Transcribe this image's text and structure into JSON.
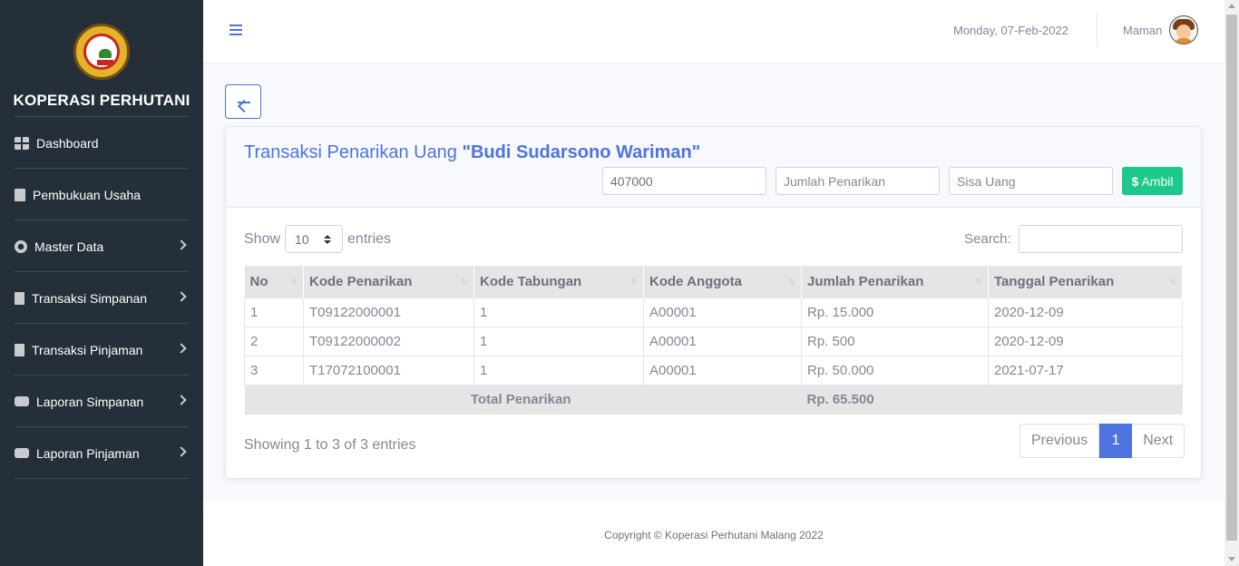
{
  "sidebar": {
    "brand": "KOPERASI PERHUTANI",
    "items": [
      {
        "label": "Dashboard"
      },
      {
        "label": "Pembukuan Usaha"
      },
      {
        "label": "Master Data"
      },
      {
        "label": "Transaksi Simpanan"
      },
      {
        "label": "Transaksi Pinjaman"
      },
      {
        "label": "Laporan Simpanan"
      },
      {
        "label": "Laporan Pinjaman"
      }
    ]
  },
  "topbar": {
    "date": "Monday, 07-Feb-2022",
    "user": "Maman"
  },
  "card": {
    "title_prefix": "Transaksi Penarikan Uang",
    "title_name": "\"Budi Sudarsono Wariman\"",
    "saldo_value": "407000",
    "jumlah_placeholder": "Jumlah Penarikan",
    "sisa_placeholder": "Sisa Uang",
    "ambil_label": "Ambil"
  },
  "table_controls": {
    "show_label": "Show",
    "entries_value": "10",
    "entries_label": "entries",
    "search_label": "Search:"
  },
  "table": {
    "headers": [
      "No",
      "Kode Penarikan",
      "Kode Tabungan",
      "Kode Anggota",
      "Jumlah Penarikan",
      "Tanggal Penarikan"
    ],
    "rows": [
      [
        "1",
        "T09122000001",
        "1",
        "A00001",
        "Rp. 15.000",
        "2020-12-09"
      ],
      [
        "2",
        "T09122000002",
        "1",
        "A00001",
        "Rp. 500",
        "2020-12-09"
      ],
      [
        "3",
        "T17072100001",
        "1",
        "A00001",
        "Rp. 50.000",
        "2021-07-17"
      ]
    ],
    "total_label": "Total Penarikan",
    "total_value": "Rp. 65.500"
  },
  "pagination": {
    "info": "Showing 1 to 3 of 3 entries",
    "previous": "Previous",
    "current": "1",
    "next": "Next"
  },
  "footer": {
    "text": "Copyright © Koperasi Perhutani Malang 2022"
  },
  "colors": {
    "primary": "#4e73df",
    "success": "#1cc88a",
    "sidebar": "#252f3a"
  }
}
